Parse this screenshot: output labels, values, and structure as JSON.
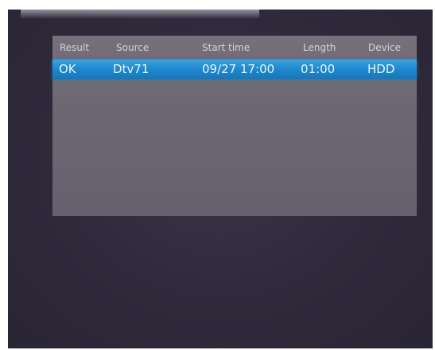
{
  "recordings_table": {
    "columns": [
      "Result",
      "Source",
      "Start time",
      "Length",
      "Device"
    ],
    "rows": [
      {
        "result": "OK",
        "source": "Dtv71",
        "start_time": "09/27 17:00",
        "length": "01:00",
        "device": "HDD"
      }
    ]
  },
  "colors": {
    "background": "#2f2a3b",
    "panel": "#6c6772",
    "selection": "#1f87cc",
    "header_text": "#d4d2dc"
  }
}
